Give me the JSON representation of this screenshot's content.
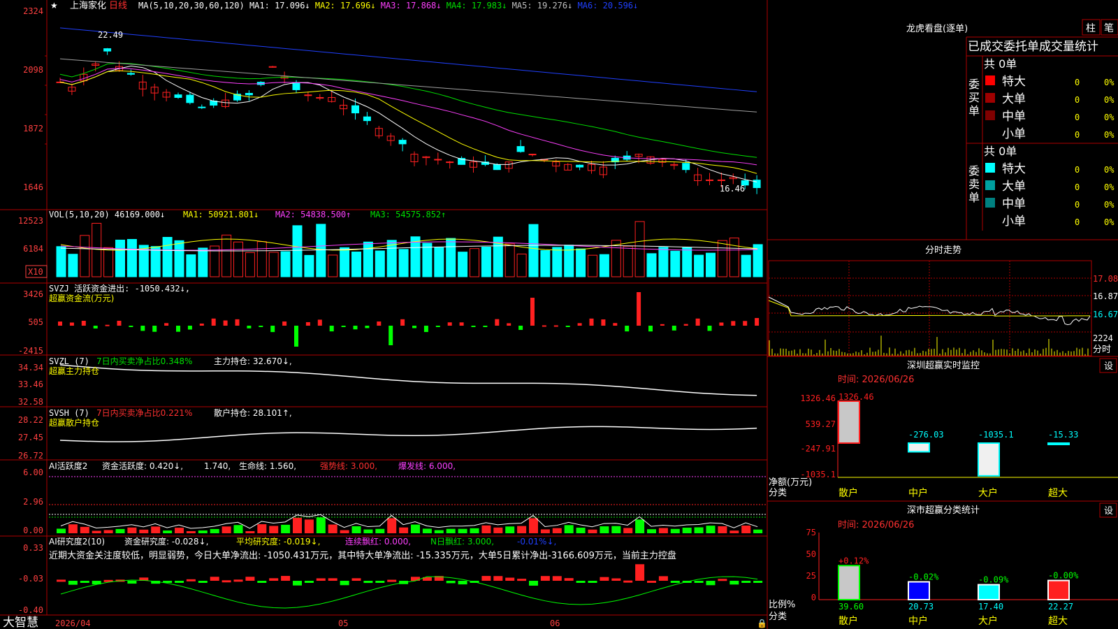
{
  "title": {
    "star": "★",
    "name": "上海家化",
    "period": "日线"
  },
  "colors": {
    "up": "#ff2020",
    "down": "#00ffff",
    "frame": "#b00000",
    "white": "#ffffff",
    "yellow": "#ffff00",
    "magenta": "#ff40ff",
    "green": "#00e000",
    "blue": "#2040ff",
    "gray": "#a0a0a0",
    "axis": "#ff4040",
    "bgcell": "#000000"
  },
  "ma_legend": [
    {
      "label": "MA(5,10,20,30,60,120)",
      "color": "#ffffff"
    },
    {
      "label": "MA1: 17.096↓",
      "color": "#ffffff"
    },
    {
      "label": "MA2: 17.696↓",
      "color": "#ffff00"
    },
    {
      "label": "MA3: 17.868↓",
      "color": "#ff40ff"
    },
    {
      "label": "MA4: 17.983↓",
      "color": "#00e000"
    },
    {
      "label": "MA5: 19.276↓",
      "color": "#c0c0c0"
    },
    {
      "label": "MA6: 20.596↓",
      "color": "#2040ff"
    }
  ],
  "price_axis": [
    "2324",
    "2098",
    "1872",
    "1646"
  ],
  "price_marks": {
    "high": "22.49",
    "low": "16.46"
  },
  "vol": {
    "legend": "VOL(5,10,20)  46169.000↓",
    "ma1": "MA1: 50921.801↓",
    "ma2": "MA2: 54838.500↑",
    "ma3": "MA3: 54575.852↑",
    "axis": [
      "12523",
      "6184"
    ],
    "unit": "X10"
  },
  "svzj": {
    "legend": "SVZJ  活跃资金进出: -1050.432↓,",
    "sub": "超赢资金流(万元)",
    "axis": [
      "3426",
      "505",
      "-2415"
    ]
  },
  "svzl": {
    "legend": "SVZL (7)",
    "legend2": "7日内买卖净占比0.348%",
    "legend3": "主力持仓: 32.670↓,",
    "sub": "超赢主力持仓",
    "axis": [
      "34.34",
      "33.46",
      "32.58"
    ]
  },
  "svsh": {
    "legend": "SVSH (7)",
    "legend2": "7日内买卖净占比0.221%",
    "legend3": "散户持仓: 28.101↑,",
    "sub": "超赢散户持仓",
    "axis": [
      "28.22",
      "27.45",
      "26.72"
    ]
  },
  "ai": {
    "l1": "AI活跃度2",
    "l2": "资金活跃度: 0.420↓,",
    "l3": "1.740,",
    "l4": "生命线: 1.560,",
    "l5": "强势线: 3.000,",
    "l6": "爆发线: 6.000,",
    "axis": [
      "6.00",
      "2.96",
      "0.00"
    ]
  },
  "air": {
    "l1": "AI研究度2(10)",
    "l2": "资金研究度: -0.028↓,",
    "l3": "平均研究度: -0.019↓,",
    "l4": "连续飘红: 0.000,",
    "l5": "N日飘红: 3.000,",
    "l6": "-0.01%↓,",
    "text": "近期大资金关注度较低，明显弱势，今日大单净流出: -1050.431万元，其中特大单净流出: -15.335万元，大单5日累计净出-3166.609万元，当前主力控盘",
    "axis": [
      "0.33",
      "-0.03",
      "-0.40"
    ]
  },
  "bottom": {
    "brand": "大智慧",
    "date1": "2026/04",
    "date2": "05",
    "date3": "06"
  },
  "lhb": {
    "title": "龙虎看盘(逐单)",
    "btn1": "柱",
    "btn2": "笔",
    "header": "已成交委托单成交量统计",
    "buy": {
      "side": "委买单",
      "total": "共 0单",
      "rows": [
        {
          "label": "特大",
          "v": "0",
          "p": "0%",
          "color": "#ff0000"
        },
        {
          "label": "大单",
          "v": "0",
          "p": "0%",
          "color": "#a00000"
        },
        {
          "label": "中单",
          "v": "0",
          "p": "0%",
          "color": "#800000"
        },
        {
          "label": "小单",
          "v": "0",
          "p": "0%",
          "color": "#000000"
        }
      ]
    },
    "sell": {
      "side": "委卖单",
      "total": "共 0单",
      "rows": [
        {
          "label": "特大",
          "v": "0",
          "p": "0%",
          "color": "#00ffff"
        },
        {
          "label": "大单",
          "v": "0",
          "p": "0%",
          "color": "#00a0a0"
        },
        {
          "label": "中单",
          "v": "0",
          "p": "0%",
          "color": "#008080"
        },
        {
          "label": "小单",
          "v": "0",
          "p": "0%",
          "color": "#000000"
        }
      ]
    }
  },
  "fs": {
    "title": "分时走势",
    "axis": [
      "17.08",
      "16.87",
      "16.67"
    ],
    "vol": "2224",
    "unit": "分时"
  },
  "mon": {
    "title": "深圳超赢实时监控",
    "set": "设",
    "time": "时间: 2026/06/26",
    "axis": [
      "1326.46",
      "539.27",
      "-247.91",
      "-1035.1"
    ],
    "ylabel": "净额(万元)",
    "xlabel": "分类",
    "values": [
      1326.46,
      -276.03,
      -1035.1,
      -15.33
    ],
    "labels": [
      "1326.46",
      "-276.03",
      "-1035.1",
      "-15.33"
    ],
    "cats": [
      "散户",
      "中户",
      "大户",
      "超大"
    ]
  },
  "stat": {
    "title": "深市超赢分类统计",
    "set": "设",
    "time": "时间: 2026/06/26",
    "axis": [
      "75",
      "50",
      "25",
      "0"
    ],
    "ylabel": "比例%",
    "xlabel": "分类",
    "values": [
      39.6,
      20.73,
      17.4,
      22.27
    ],
    "changes": [
      "+0.12%",
      "-0.02%",
      "-0.09%",
      "-0.00%"
    ],
    "vals": [
      "39.60",
      "20.73",
      "17.40",
      "22.27"
    ],
    "cats": [
      "散户",
      "中户",
      "大户",
      "超大"
    ]
  }
}
